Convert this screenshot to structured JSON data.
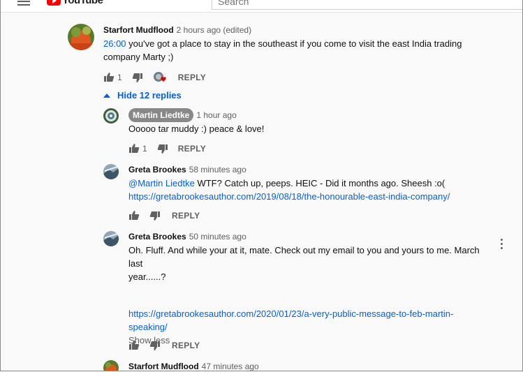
{
  "header": {
    "logo_text": "YouTube",
    "search_placeholder": "Search"
  },
  "comments": [
    {
      "author": "Starfort Mudflood",
      "time": "2 hours ago (edited)",
      "timestamp_link": "26:00",
      "text": " you've got a place to stay in the southeast if you come to visit the east India trading company Marty ;)",
      "likes": "1",
      "reply_label": "REPLY"
    }
  ],
  "replies_toggle": "Hide 12 replies",
  "replies": [
    {
      "author": "Martin Liedtke",
      "time": "1 hour ago",
      "text": "Ooooo tar muddy :) peace & love!",
      "likes": "1",
      "reply_label": "REPLY"
    },
    {
      "author": "Greta Brookes",
      "time": "58 minutes ago",
      "mention": "@Martin Liedtke",
      "text": " WTF? Catch up, peeps. HEIC - Did it months ago. Sheesh :o(",
      "link": "https://gretabrookesauthor.com/2019/08/18/the-honourable-east-india-company/",
      "reply_label": "REPLY"
    },
    {
      "author": "Greta Brookes",
      "time": "50 minutes ago",
      "text_line1": "Oh. Fluff. And while your at it, mate. Check out my email to you and yours to me. March last",
      "text_line2": "year......?",
      "link_line1": "https://gretabrookesauthor.com/2020/01/23/a-very-public-message-to-feb-martin-",
      "link_line2": "speaking/",
      "show_less": "Show less",
      "reply_label": "REPLY"
    },
    {
      "author": "Starfort Mudflood",
      "time": "47 minutes ago"
    }
  ]
}
